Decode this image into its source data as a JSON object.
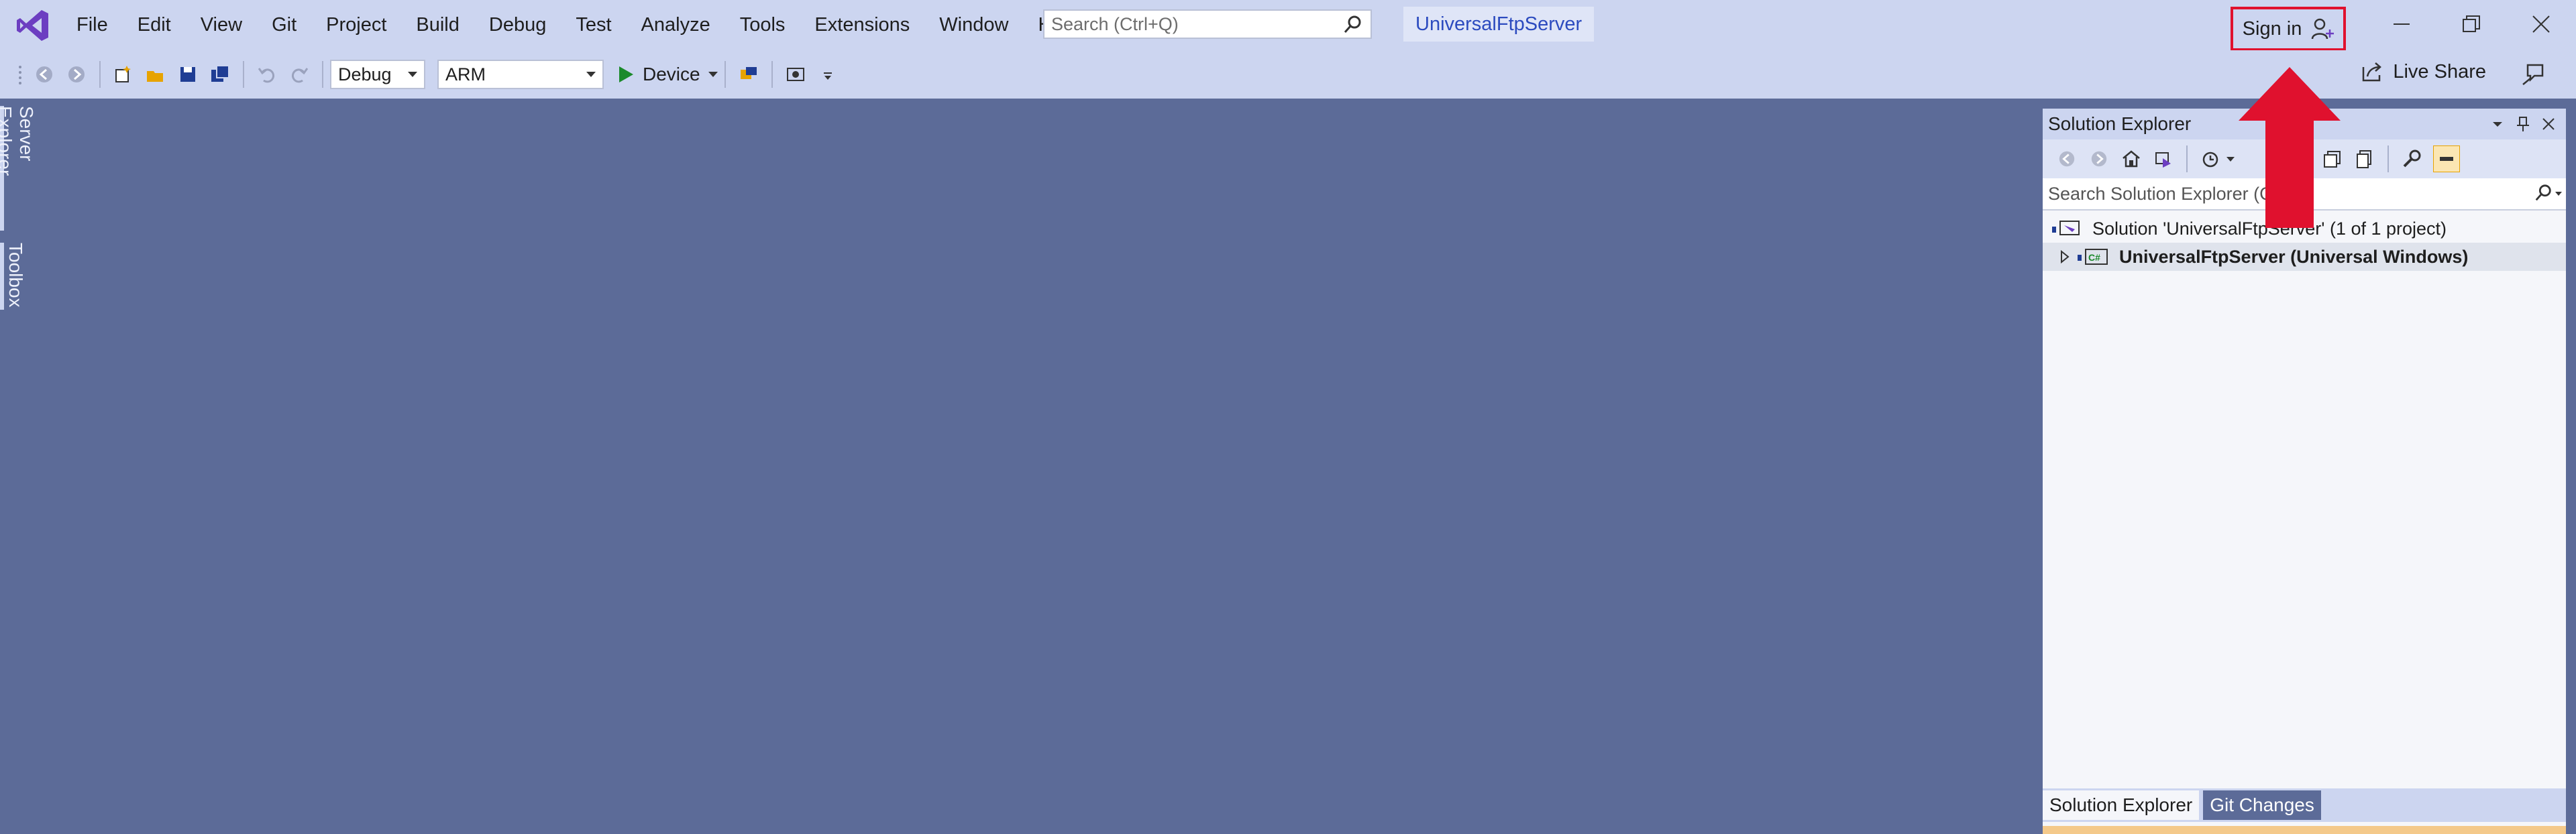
{
  "menu": [
    "File",
    "Edit",
    "View",
    "Git",
    "Project",
    "Build",
    "Debug",
    "Test",
    "Analyze",
    "Tools",
    "Extensions",
    "Window",
    "Help"
  ],
  "search": {
    "placeholder": "Search (Ctrl+Q)"
  },
  "solution_name": "UniversalFtpServer",
  "signin": {
    "label": "Sign in"
  },
  "toolbar": {
    "config": "Debug",
    "platform": "ARM",
    "run_label": "Device",
    "liveshare": "Live Share"
  },
  "sidetabs": {
    "server_explorer": "Server Explorer",
    "toolbox": "Toolbox"
  },
  "solution_explorer": {
    "title": "Solution Explorer",
    "search_placeholder": "Search Solution Explorer (C",
    "tree": [
      {
        "label": "Solution 'UniversalFtpServer' (1 of 1 project)"
      },
      {
        "label": "UniversalFtpServer (Universal Windows)"
      }
    ],
    "tabs": [
      "Solution Explorer",
      "Git Changes"
    ]
  },
  "colors": {
    "accent": "#2c4bbf",
    "highlight_box": "#e0112e",
    "vs_purple": "#6c3ec1"
  }
}
